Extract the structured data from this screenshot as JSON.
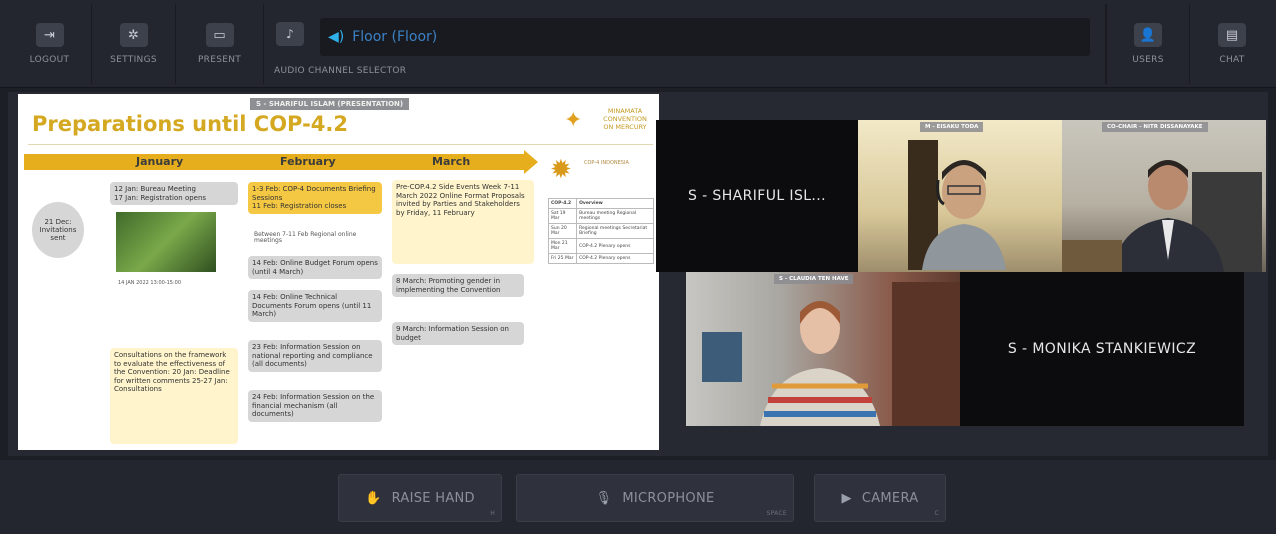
{
  "toolbar": {
    "logout": "LOGOUT",
    "settings": "SETTINGS",
    "present": "PRESENT",
    "audio_channel_label": "AUDIO CHANNEL SELECTOR",
    "audio_channel_value": "Floor (Floor)",
    "users": "USERS",
    "chat": "CHAT"
  },
  "slide": {
    "presenter_tag": "S - SHARIFUL ISLAM (PRESENTATION)",
    "title": "Preparations until COP-4.2",
    "logo_text": [
      "MINAMATA",
      "CONVENTION",
      "ON MERCURY"
    ],
    "months": [
      "January",
      "February",
      "March"
    ],
    "jan_bureau": "12 Jan: Bureau Meeting\n17 Jan: Registration opens",
    "dec_invites": "21 Dec: Invitations sent",
    "photo_caption": "14 JAN 2022 13:00-15:00",
    "jan_consult": "Consultations on the framework to evaluate the effectiveness of the Convention: 20 Jan: Deadline for written comments 25-27 Jan: Consultations",
    "feb_docs": "1-3 Feb: COP-4 Documents Briefing Sessions\n11 Feb: Registration closes",
    "feb_between": "Between 7-11 Feb    Regional online meetings",
    "feb_budget": "14 Feb: Online Budget Forum opens (until 4 March)",
    "feb_technical": "14 Feb: Online Technical Documents Forum opens (until 11 March)",
    "feb_info_reporting": "23 Feb: Information Session on national reporting and compliance (all documents)",
    "feb_info_financial": "24 Feb: Information Session on the financial mechanism (all documents)",
    "mar_precop": "Pre-COP.4.2 Side Events Week 7-11 March 2022 Online Format Proposals invited by Parties and Stakeholders by Friday, 11 February",
    "mar_gender": "8 March: Promoting gender in implementing the Convention",
    "mar_budget": "9 March: Information Session on budget",
    "cop_logo_text": "COP-4 INDONESIA",
    "table_headers": [
      "COP-4.2",
      "Overview"
    ],
    "table_rows": [
      [
        "Sat 19 Mar",
        "Bureau meeting Regional meetings"
      ],
      [
        "Sun 20 Mar",
        "Regional meetings Secretariat Briefing"
      ],
      [
        "Mon 21 Mar",
        "COP-4.2 Plenary opens"
      ],
      [
        "Fri 25 Mar",
        "COP-4.2 Plenary opens"
      ]
    ]
  },
  "videos": {
    "shariful_name": "S - SHARIFUL ISL...",
    "toda_badge": "M - EISAKU TODA",
    "cochair_badge": "CO-CHAIR - NITR DISSANAYAKE",
    "claudia_badge": "S - CLAUDIA TEN HAVE",
    "monika_name": "S - MONIKA STANKIEWICZ"
  },
  "bottom": {
    "raise_hand": "RAISE HAND",
    "raise_hand_key": "H",
    "microphone": "MICROPHONE",
    "microphone_key": "SPACE",
    "camera": "CAMERA",
    "camera_key": "C"
  }
}
